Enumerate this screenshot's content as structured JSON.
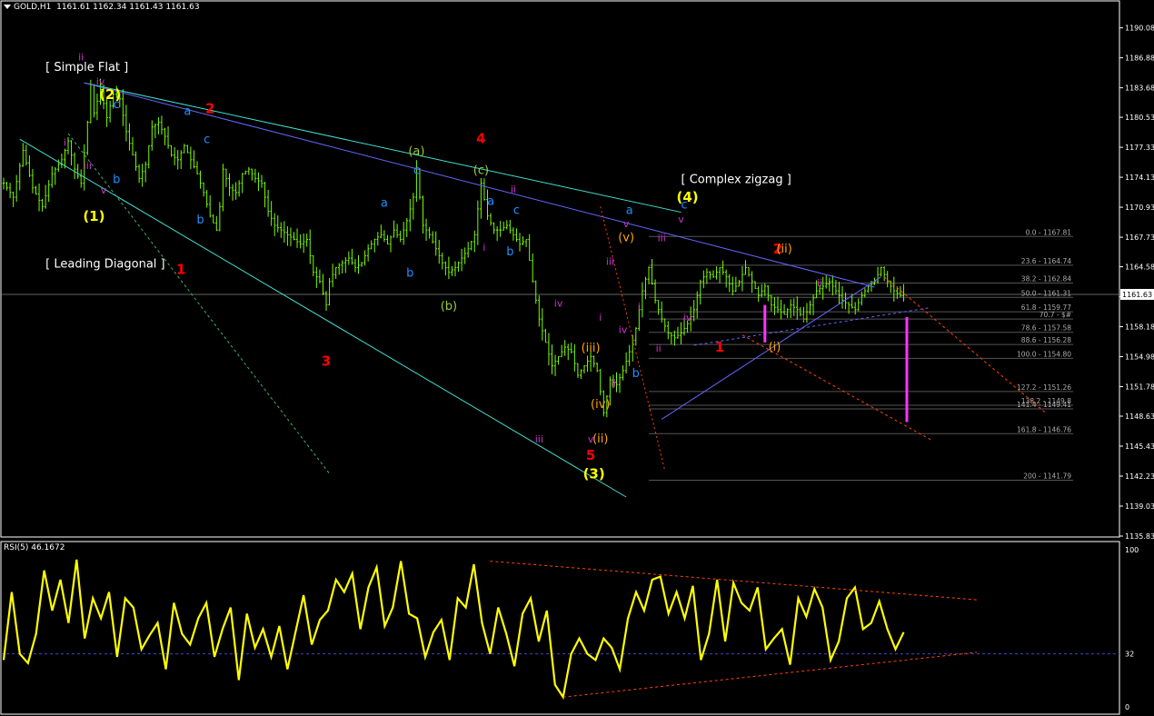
{
  "header": {
    "symbol": "GOLD,H1",
    "ohlc": "1161.61 1162.34 1161.43 1161.63"
  },
  "rsi_header": "RSI(5) 46.1672",
  "colors": {
    "background": "#000000",
    "candle": "#7CFC00",
    "rsi": "#FFFF00",
    "grid_text": "#FFFFFF",
    "label_red": "#FF0000",
    "label_yellow": "#FFFF00",
    "label_blue": "#1E90FF",
    "label_magenta": "#CC33CC",
    "label_olive": "#9ACD32",
    "label_orange": "#FFA500",
    "trend_cyan": "#40E0D0",
    "trend_blue": "#6666FF",
    "trend_orange": "#FF4500"
  },
  "chart_data": [
    {
      "type": "candlestick",
      "title": "GOLD,H1",
      "ylim": [
        1135.83,
        1191.5
      ],
      "y_ticks": [
        "1190.08",
        "1186.88",
        "1183.68",
        "1180.53",
        "1177.33",
        "1174.13",
        "1170.93",
        "1167.73",
        "1164.58",
        "1161.38",
        "1158.18",
        "1154.98",
        "1151.78",
        "1148.63",
        "1145.43",
        "1142.23",
        "1139.03",
        "1135.83"
      ],
      "current_price": "1161.63",
      "close_path": [
        [
          0,
          1173.5
        ],
        [
          3,
          1172.0
        ],
        [
          6,
          1177.0
        ],
        [
          9,
          1173.0
        ],
        [
          12,
          1171.0
        ],
        [
          15,
          1174.5
        ],
        [
          18,
          1176.0
        ],
        [
          20,
          1178.0
        ],
        [
          22,
          1175.0
        ],
        [
          24,
          1173.5
        ],
        [
          26,
          1180.0
        ],
        [
          27,
          1184.0
        ],
        [
          28,
          1181.0
        ],
        [
          30,
          1183.5
        ],
        [
          32,
          1180.5
        ],
        [
          34,
          1183.0
        ],
        [
          36,
          1182.5
        ],
        [
          38,
          1179.0
        ],
        [
          40,
          1176.5
        ],
        [
          42,
          1174.0
        ],
        [
          44,
          1175.5
        ],
        [
          46,
          1179.5
        ],
        [
          48,
          1180.0
        ],
        [
          50,
          1178.5
        ],
        [
          52,
          1176.5
        ],
        [
          54,
          1176.0
        ],
        [
          56,
          1177.5
        ],
        [
          58,
          1176.0
        ],
        [
          60,
          1174.5
        ],
        [
          62,
          1172.5
        ],
        [
          64,
          1170.0
        ],
        [
          66,
          1168.5
        ],
        [
          67,
          1171.0
        ],
        [
          68,
          1175.0
        ],
        [
          70,
          1173.0
        ],
        [
          72,
          1172.5
        ],
        [
          74,
          1174.5
        ],
        [
          76,
          1175.0
        ],
        [
          78,
          1174.0
        ],
        [
          80,
          1173.5
        ],
        [
          82,
          1170.5
        ],
        [
          84,
          1169.0
        ],
        [
          86,
          1168.5
        ],
        [
          88,
          1168.0
        ],
        [
          90,
          1167.5
        ],
        [
          92,
          1167.0
        ],
        [
          94,
          1167.5
        ],
        [
          96,
          1164.0
        ],
        [
          98,
          1163.0
        ],
        [
          100,
          1160.5
        ],
        [
          101,
          1163.0
        ],
        [
          103,
          1164.5
        ],
        [
          105,
          1165.0
        ],
        [
          107,
          1165.5
        ],
        [
          109,
          1164.5
        ],
        [
          111,
          1165.0
        ],
        [
          113,
          1166.5
        ],
        [
          115,
          1167.5
        ],
        [
          117,
          1168.0
        ],
        [
          119,
          1167.0
        ],
        [
          121,
          1168.5
        ],
        [
          123,
          1167.5
        ],
        [
          125,
          1169.5
        ],
        [
          127,
          1172.0
        ],
        [
          128,
          1175.0
        ],
        [
          130,
          1169.0
        ],
        [
          132,
          1168.0
        ],
        [
          134,
          1166.5
        ],
        [
          136,
          1165.0
        ],
        [
          138,
          1164.0
        ],
        [
          140,
          1164.5
        ],
        [
          142,
          1165.5
        ],
        [
          144,
          1166.5
        ],
        [
          146,
          1168.0
        ],
        [
          148,
          1173.5
        ],
        [
          150,
          1170.0
        ],
        [
          152,
          1168.5
        ],
        [
          154,
          1168.5
        ],
        [
          156,
          1169.0
        ],
        [
          158,
          1168.0
        ],
        [
          160,
          1167.0
        ],
        [
          162,
          1167.5
        ],
        [
          164,
          1163.0
        ],
        [
          166,
          1159.0
        ],
        [
          168,
          1156.5
        ],
        [
          170,
          1154.0
        ],
        [
          172,
          1155.0
        ],
        [
          174,
          1156.0
        ],
        [
          176,
          1155.5
        ],
        [
          178,
          1153.0
        ],
        [
          180,
          1154.0
        ],
        [
          182,
          1155.0
        ],
        [
          184,
          1153.5
        ],
        [
          186,
          1149.0
        ],
        [
          188,
          1152.5
        ],
        [
          190,
          1152.0
        ],
        [
          192,
          1153.5
        ],
        [
          194,
          1155.5
        ],
        [
          196,
          1158.0
        ],
        [
          198,
          1162.0
        ],
        [
          200,
          1164.5
        ],
        [
          202,
          1161.0
        ],
        [
          204,
          1159.0
        ],
        [
          206,
          1157.5
        ],
        [
          208,
          1157.0
        ],
        [
          210,
          1157.5
        ],
        [
          212,
          1158.5
        ],
        [
          214,
          1160.0
        ],
        [
          216,
          1163.0
        ],
        [
          218,
          1164.0
        ],
        [
          220,
          1163.5
        ],
        [
          222,
          1164.5
        ],
        [
          224,
          1163.5
        ],
        [
          226,
          1162.0
        ],
        [
          228,
          1163.0
        ],
        [
          230,
          1164.5
        ],
        [
          232,
          1163.0
        ],
        [
          234,
          1161.5
        ],
        [
          236,
          1162.5
        ],
        [
          238,
          1160.5
        ],
        [
          240,
          1160.0
        ],
        [
          242,
          1159.5
        ],
        [
          244,
          1160.5
        ],
        [
          246,
          1160.0
        ],
        [
          248,
          1159.0
        ],
        [
          250,
          1160.5
        ],
        [
          252,
          1162.0
        ],
        [
          254,
          1162.5
        ],
        [
          256,
          1163.0
        ],
        [
          258,
          1162.0
        ],
        [
          260,
          1161.0
        ],
        [
          262,
          1160.5
        ],
        [
          264,
          1160.0
        ],
        [
          266,
          1161.5
        ],
        [
          268,
          1162.5
        ],
        [
          270,
          1163.0
        ],
        [
          272,
          1164.5
        ],
        [
          274,
          1163.0
        ],
        [
          276,
          1162.0
        ],
        [
          278,
          1161.5
        ],
        [
          279,
          1161.63
        ]
      ],
      "fib_levels": [
        {
          "ratio": "0.0",
          "price": "1167.81"
        },
        {
          "ratio": "23.6",
          "price": "1164.74"
        },
        {
          "ratio": "38.2",
          "price": "1162.84"
        },
        {
          "ratio": "50.0",
          "price": "1161.31"
        },
        {
          "ratio": "61.8",
          "price": "1159.77"
        },
        {
          "ratio": "70.7",
          "price": "$#"
        },
        {
          "ratio": "78.6",
          "price": "1157.58"
        },
        {
          "ratio": "88.6",
          "price": "1156.28"
        },
        {
          "ratio": "100.0",
          "price": "1154.80"
        },
        {
          "ratio": "127.2",
          "price": "1151.26"
        },
        {
          "ratio": "138.2",
          "price": "1149.8"
        },
        {
          "ratio": "141.4",
          "price": "1149.41"
        },
        {
          "ratio": "161.8",
          "price": "1146.76"
        },
        {
          "ratio": "200",
          "price": "1141.79"
        }
      ],
      "wave_labels": [
        {
          "text": "[ Simple Flat ]",
          "x": 13,
          "price": 1185.5,
          "color": "#FFFFFF"
        },
        {
          "text": "[ Leading Diagonal ]",
          "x": 13,
          "price": 1164.5,
          "color": "#FFFFFF"
        },
        {
          "text": "[ Complex zigzag ]",
          "x": 210,
          "price": 1173.5,
          "color": "#FFFFFF"
        },
        {
          "text": "(2)",
          "x": 33,
          "price": 1182.5,
          "color": "#FFFF00"
        },
        {
          "text": "(1)",
          "x": 28,
          "price": 1169.5,
          "color": "#FFFF00"
        },
        {
          "text": "(a)",
          "x": 128,
          "price": 1176.5,
          "color": "#9ACD32"
        },
        {
          "text": "(b)",
          "x": 138,
          "price": 1160.0,
          "color": "#9ACD32"
        },
        {
          "text": "(c)",
          "x": 148,
          "price": 1174.5,
          "color": "#9ACD32"
        },
        {
          "text": "(4)",
          "x": 212,
          "price": 1171.5,
          "color": "#FFFF00"
        },
        {
          "text": "(3)",
          "x": 183,
          "price": 1142.0,
          "color": "#FFFF00"
        },
        {
          "text": "1",
          "x": 55,
          "price": 1163.8,
          "color": "#FF0000"
        },
        {
          "text": "2",
          "x": 64,
          "price": 1181.0,
          "color": "#FF0000"
        },
        {
          "text": "3",
          "x": 100,
          "price": 1154.0,
          "color": "#FF0000"
        },
        {
          "text": "4",
          "x": 148,
          "price": 1177.8,
          "color": "#FF0000"
        },
        {
          "text": "5",
          "x": 182,
          "price": 1144.0,
          "color": "#FF0000"
        },
        {
          "text": "1",
          "x": 222,
          "price": 1155.5,
          "color": "#FF0000"
        },
        {
          "text": "2",
          "x": 240,
          "price": 1166.0,
          "color": "#FF0000"
        },
        {
          "text": "a",
          "x": 57,
          "price": 1180.8,
          "color": "#1E90FF"
        },
        {
          "text": "b",
          "x": 35,
          "price": 1173.5,
          "color": "#1E90FF"
        },
        {
          "text": "c",
          "x": 35,
          "price": 1181.5,
          "color": "#1E90FF"
        },
        {
          "text": "b",
          "x": 61,
          "price": 1169.2,
          "color": "#1E90FF"
        },
        {
          "text": "c",
          "x": 63,
          "price": 1177.8,
          "color": "#1E90FF"
        },
        {
          "text": "a",
          "x": 118,
          "price": 1171.0,
          "color": "#1E90FF"
        },
        {
          "text": "b",
          "x": 126,
          "price": 1163.5,
          "color": "#1E90FF"
        },
        {
          "text": "c",
          "x": 128,
          "price": 1174.5,
          "color": "#1E90FF"
        },
        {
          "text": "a",
          "x": 151,
          "price": 1171.2,
          "color": "#1E90FF"
        },
        {
          "text": "c",
          "x": 159,
          "price": 1170.2,
          "color": "#1E90FF"
        },
        {
          "text": "b",
          "x": 157,
          "price": 1165.8,
          "color": "#1E90FF"
        },
        {
          "text": "a",
          "x": 194,
          "price": 1170.2,
          "color": "#1E90FF"
        },
        {
          "text": "b",
          "x": 196,
          "price": 1152.8,
          "color": "#1E90FF"
        },
        {
          "text": "c",
          "x": 211,
          "price": 1170.8,
          "color": "#1E90FF"
        },
        {
          "text": "ii",
          "x": 24,
          "price": 1186.6,
          "color": "#CC33CC"
        },
        {
          "text": "iv",
          "x": 30,
          "price": 1184.0,
          "color": "#CC33CC"
        },
        {
          "text": "i",
          "x": 19,
          "price": 1177.5,
          "color": "#CC33CC"
        },
        {
          "text": "iii",
          "x": 26,
          "price": 1175.0,
          "color": "#CC33CC"
        },
        {
          "text": "v",
          "x": 31,
          "price": 1172.4,
          "color": "#CC33CC"
        },
        {
          "text": "ii",
          "x": 158,
          "price": 1172.5,
          "color": "#CC33CC"
        },
        {
          "text": "i",
          "x": 149,
          "price": 1166.3,
          "color": "#CC33CC"
        },
        {
          "text": "iv",
          "x": 172,
          "price": 1160.3,
          "color": "#CC33CC"
        },
        {
          "text": "iii",
          "x": 166,
          "price": 1145.8,
          "color": "#CC33CC"
        },
        {
          "text": "v",
          "x": 182,
          "price": 1145.8,
          "color": "#CC33CC"
        },
        {
          "text": "iii",
          "x": 188,
          "price": 1164.8,
          "color": "#CC33CC"
        },
        {
          "text": "i",
          "x": 185,
          "price": 1158.8,
          "color": "#CC33CC"
        },
        {
          "text": "iv",
          "x": 192,
          "price": 1157.5,
          "color": "#CC33CC"
        },
        {
          "text": "ii",
          "x": 189,
          "price": 1151.8,
          "color": "#CC33CC"
        },
        {
          "text": "v",
          "x": 193,
          "price": 1168.8,
          "color": "#CC33CC"
        },
        {
          "text": "iii",
          "x": 204,
          "price": 1167.3,
          "color": "#CC33CC"
        },
        {
          "text": "ii",
          "x": 203,
          "price": 1155.5,
          "color": "#CC33CC"
        },
        {
          "text": "i",
          "x": 197,
          "price": 1160.0,
          "color": "#CC33CC"
        },
        {
          "text": "v",
          "x": 210,
          "price": 1169.3,
          "color": "#CC33CC"
        },
        {
          "text": "iv",
          "x": 212,
          "price": 1158.8,
          "color": "#CC33CC"
        },
        {
          "text": "i",
          "x": 248,
          "price": 1158.8,
          "color": "#CC33CC"
        },
        {
          "text": "ii",
          "x": 253,
          "price": 1162.5,
          "color": "#CC33CC"
        },
        {
          "text": "(v)",
          "x": 193,
          "price": 1167.3,
          "color": "#FFA500"
        },
        {
          "text": "(iii)",
          "x": 182,
          "price": 1155.5,
          "color": "#FFA500"
        },
        {
          "text": "(iv)",
          "x": 185,
          "price": 1149.5,
          "color": "#FFA500"
        },
        {
          "text": "(ii)",
          "x": 185,
          "price": 1145.8,
          "color": "#FFA500"
        },
        {
          "text": "(ii)",
          "x": 242,
          "price": 1166.1,
          "color": "#FFA500"
        },
        {
          "text": "(i)",
          "x": 239,
          "price": 1155.6,
          "color": "#FFA500"
        }
      ]
    },
    {
      "type": "line",
      "title": "RSI(5) 46.1672",
      "ylim": [
        0,
        100
      ],
      "y_ticks": [
        "100",
        "32",
        "0"
      ],
      "values": [
        28,
        72,
        32,
        26,
        45,
        86,
        60,
        80,
        52,
        93,
        42,
        68,
        55,
        72,
        30,
        68,
        62,
        35,
        44,
        52,
        22,
        65,
        45,
        38,
        55,
        65,
        30,
        48,
        62,
        15,
        58,
        36,
        48,
        30,
        50,
        22,
        46,
        70,
        38,
        54,
        60,
        80,
        72,
        84,
        48,
        75,
        88,
        50,
        62,
        92,
        58,
        55,
        30,
        46,
        54,
        28,
        68,
        62,
        90,
        52,
        32,
        62,
        45,
        24,
        58,
        68,
        40,
        60,
        12,
        4,
        32,
        42,
        32,
        28,
        42,
        36,
        22,
        55,
        72,
        60,
        80,
        82,
        58,
        72,
        55,
        76,
        28,
        45,
        80,
        40,
        78,
        65,
        60,
        75,
        35,
        42,
        48,
        25,
        68,
        56,
        74,
        62,
        28,
        40,
        68,
        75,
        48,
        52,
        66,
        48,
        35,
        46
      ]
    }
  ]
}
